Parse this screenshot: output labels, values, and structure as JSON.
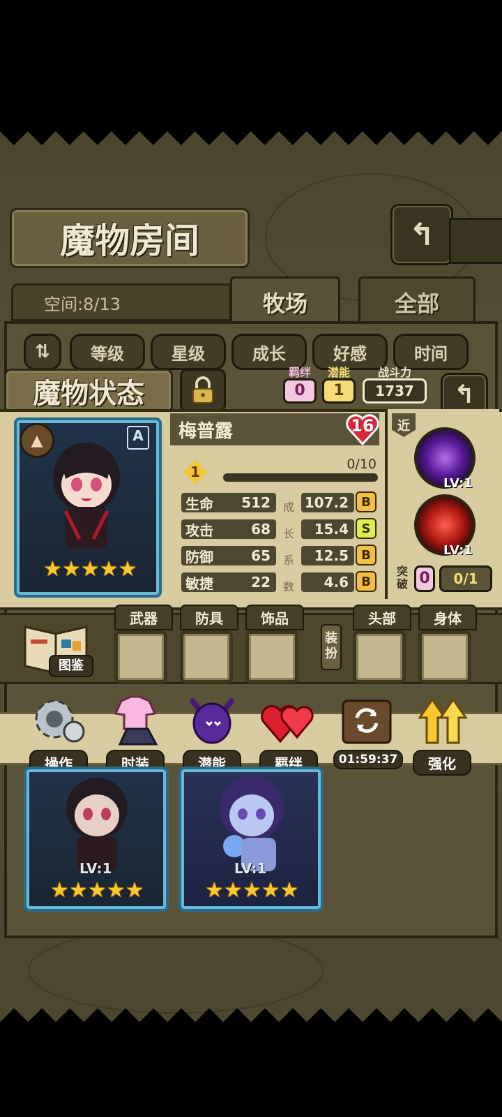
{
  "header": {
    "title": "魔物房间",
    "back_icon": "return-icon"
  },
  "space": {
    "label": "空间:8/13"
  },
  "tabs": [
    {
      "label": "牧场"
    },
    {
      "label": "全部"
    }
  ],
  "sort_buttons": [
    "等级",
    "星级",
    "成长",
    "好感",
    "时间"
  ],
  "status_panel": {
    "title": "魔物状态",
    "bond_label": "羁绊",
    "bond_value": "0",
    "potential_label": "潜能",
    "potential_value": "1",
    "power_label": "战斗力",
    "power_value": "1737",
    "monster_name": "梅普露",
    "level": "16",
    "card_rank": "A",
    "star_count": 5,
    "exp_level": "1",
    "exp_text": "0/10",
    "exp_fraction": 0,
    "growth_label_chars": [
      "成",
      "长",
      "系",
      "数"
    ],
    "stats": [
      {
        "label": "生命",
        "value": "512",
        "growth": "107.2",
        "grade": "B"
      },
      {
        "label": "攻击",
        "value": "68",
        "growth": "15.4",
        "grade": "S"
      },
      {
        "label": "防御",
        "value": "65",
        "growth": "12.5",
        "grade": "B"
      },
      {
        "label": "敏捷",
        "value": "22",
        "growth": "4.6",
        "grade": "B"
      }
    ],
    "range_tag": "近",
    "skills": [
      {
        "level": "LV:1",
        "color": "#7a3ab8"
      },
      {
        "level": "LV:1",
        "color": "#c0201a"
      }
    ],
    "breakthrough_label": "突破",
    "breakthrough_value": "0",
    "breakthrough_progress": "0/1"
  },
  "equipment": {
    "album_label": "图鉴",
    "dress_up_label": "装扮",
    "slots": [
      "武器",
      "防具",
      "饰品",
      "头部",
      "身体"
    ]
  },
  "actions": [
    {
      "label": "操作",
      "icon": "gear-icon"
    },
    {
      "label": "时装",
      "icon": "outfit-icon"
    },
    {
      "label": "潜能",
      "icon": "potential-demon-icon"
    },
    {
      "label": "羁绊",
      "icon": "bond-hearts-icon"
    },
    {
      "label": "01:59:37",
      "icon": "refresh-chest-icon"
    },
    {
      "label": "强化",
      "icon": "upgrade-arrows-icon"
    }
  ],
  "monster_cards": [
    {
      "level": "LV:1",
      "stars": 5,
      "theme": "#2f3d50"
    },
    {
      "level": "LV:1",
      "stars": 5,
      "theme": "#3a3f66"
    }
  ]
}
